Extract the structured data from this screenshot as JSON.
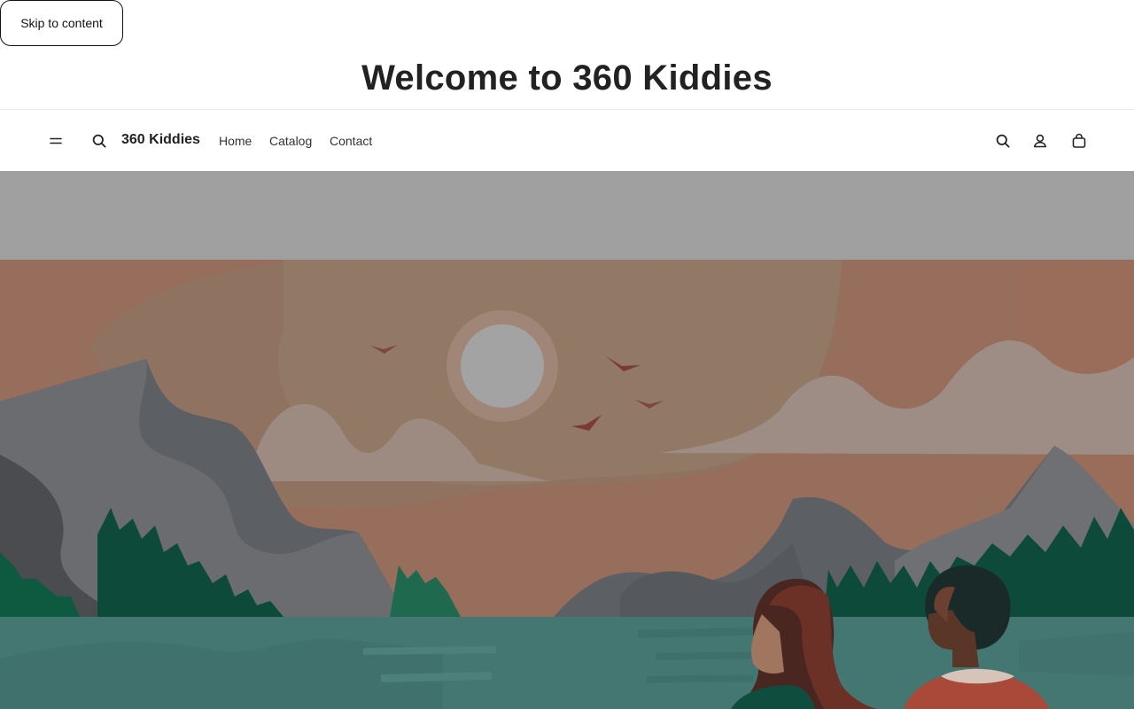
{
  "skip_link": {
    "label": "Skip to content"
  },
  "announcement": {
    "title": "Welcome to 360 Kiddies"
  },
  "header": {
    "menu_icon": "hamburger-icon",
    "search_icon": "search-icon",
    "brand": "360 Kiddies",
    "nav": [
      {
        "label": "Home"
      },
      {
        "label": "Catalog"
      },
      {
        "label": "Contact"
      }
    ],
    "right_icons": [
      "search-icon",
      "account-icon",
      "cart-icon"
    ]
  },
  "hero": {
    "top_band_color": "#a0a0a0",
    "illustration": "sunset-mountain-lake-illustration"
  }
}
